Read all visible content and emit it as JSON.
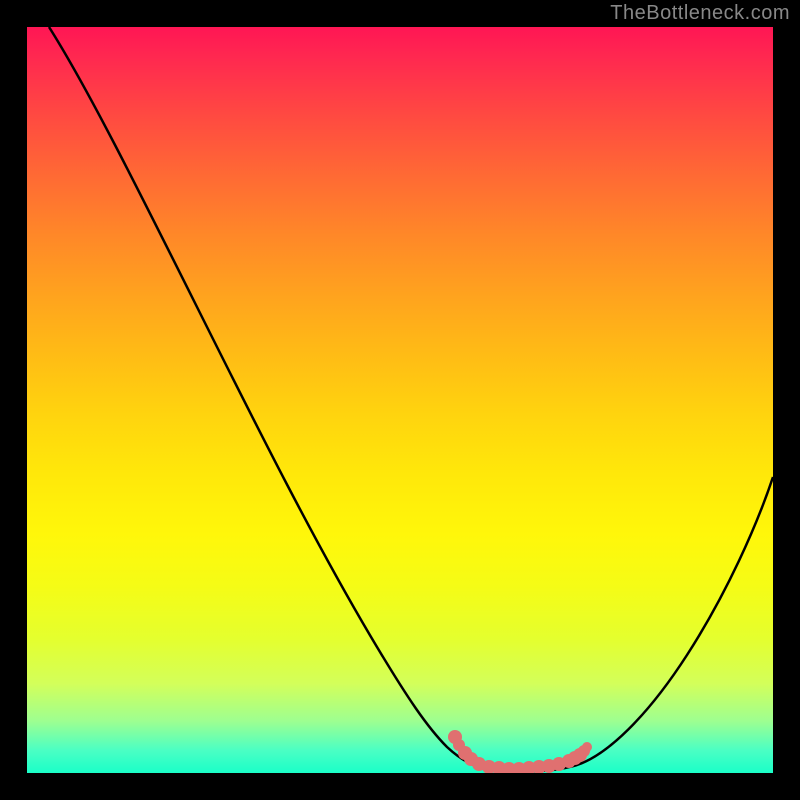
{
  "watermark": "TheBottleneck.com",
  "chart_data": {
    "type": "line",
    "title": "",
    "xlabel": "",
    "ylabel": "",
    "x_range": [
      0,
      100
    ],
    "y_range": [
      0,
      100
    ],
    "series": [
      {
        "name": "bottleneck-curve",
        "color": "#000000",
        "x": [
          3,
          10,
          20,
          30,
          40,
          48,
          52,
          55,
          58,
          62,
          66,
          70,
          74,
          80,
          88,
          96,
          100
        ],
        "y": [
          100,
          89,
          73,
          56,
          38,
          22,
          13,
          7,
          3,
          1,
          0,
          0,
          1,
          5,
          16,
          32,
          42
        ]
      },
      {
        "name": "optimal-highlight",
        "color": "#e07070",
        "x": [
          55,
          58,
          60,
          64,
          68,
          72,
          74
        ],
        "y": [
          7,
          3,
          2,
          0.5,
          0.5,
          1,
          1.5
        ]
      }
    ],
    "optimal_x": 68,
    "gradient_stops": [
      {
        "pos": 0,
        "color": "#ff1654"
      },
      {
        "pos": 50,
        "color": "#ffdc0c"
      },
      {
        "pos": 82,
        "color": "#f0ff22"
      },
      {
        "pos": 100,
        "color": "#1affc8"
      }
    ]
  }
}
